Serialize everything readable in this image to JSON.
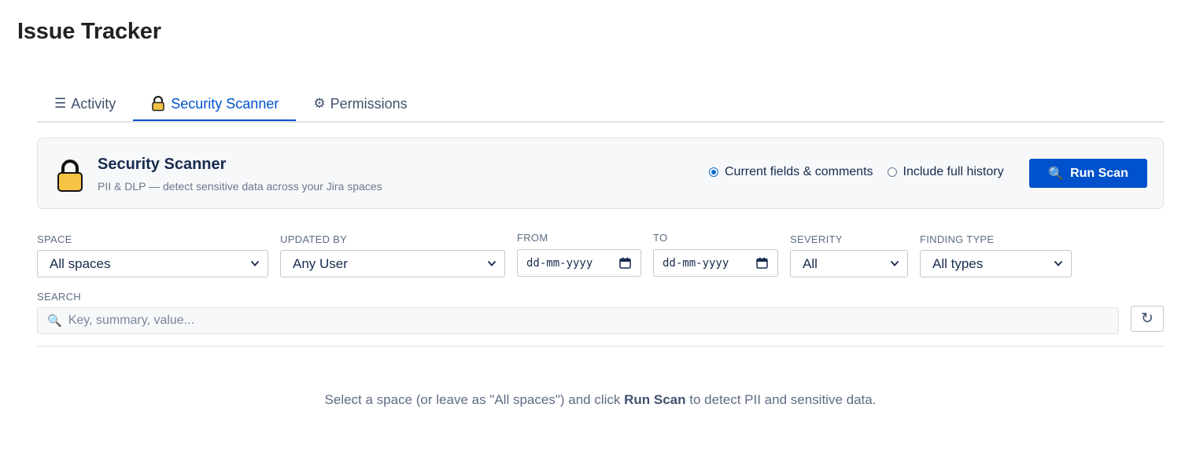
{
  "app": {
    "title": "Issue Tracker"
  },
  "tabs": [
    {
      "label": "Activity",
      "icon": "list-icon",
      "active": false
    },
    {
      "label": "Security Scanner",
      "icon": "lock-icon",
      "active": true
    },
    {
      "label": "Permissions",
      "icon": "gear-icon",
      "active": false
    }
  ],
  "scanner": {
    "title": "Security Scanner",
    "subtitle": "PII & DLP — detect sensitive data across your Jira spaces",
    "modes": [
      {
        "label": "Current fields & comments",
        "selected": true
      },
      {
        "label": "Include full history",
        "selected": false
      }
    ],
    "run_label": "Run Scan"
  },
  "filters": {
    "space": {
      "label": "SPACE",
      "value": "All spaces"
    },
    "updated_by": {
      "label": "UPDATED BY",
      "value": "Any User"
    },
    "from": {
      "label": "FROM",
      "value": "dd-mm-yyyy"
    },
    "to": {
      "label": "TO",
      "value": "dd-mm-yyyy"
    },
    "severity": {
      "label": "SEVERITY",
      "value": "All"
    },
    "finding_type": {
      "label": "FINDING TYPE",
      "value": "All types"
    }
  },
  "search": {
    "label": "SEARCH",
    "placeholder": "Key, summary, value..."
  },
  "empty_state": {
    "before": "Select a space (or leave as \"All spaces\") and click ",
    "strong": "Run Scan",
    "after": " to detect PII and sensitive data."
  },
  "colors": {
    "accent": "#0052cc",
    "card_bg": "#f7f8fa",
    "border": "#dfe1e6"
  }
}
